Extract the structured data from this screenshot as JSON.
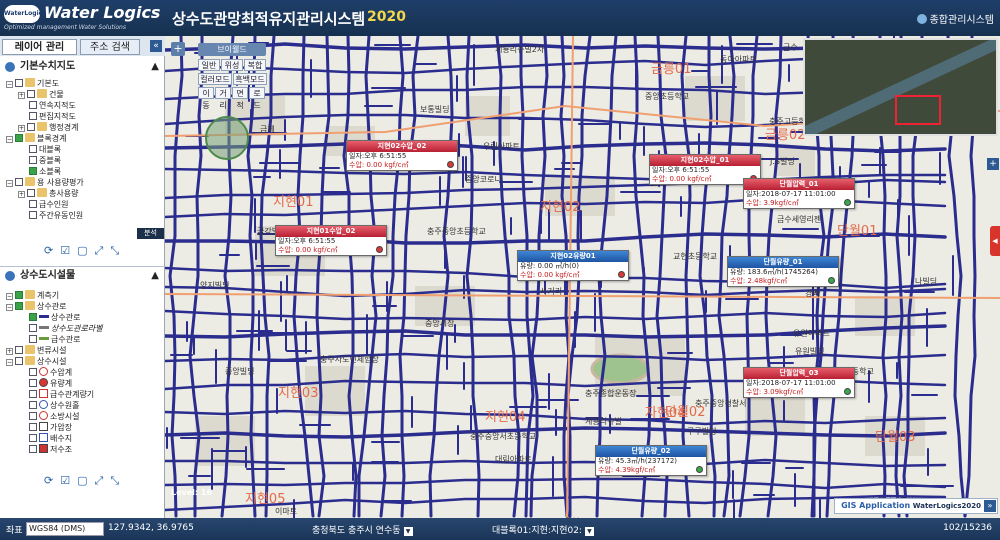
{
  "header": {
    "logo_mark": "WaterLogics",
    "logo_name": "Water Logics",
    "logo_tagline": "Optimized management Water Solutions",
    "title": "상수도관망최적유지관리시스템",
    "year": "2020",
    "global_link": "종합관리시스템"
  },
  "left_panel": {
    "tabs": [
      "레이어 관리",
      "주소 검색"
    ],
    "collapse": "«",
    "section_basic": "기본수치지도",
    "basic_items": [
      "기본도",
      "건물",
      "연속지적도",
      "편집지적도",
      "행정경계",
      "블록경계",
      "대블록",
      "중블록",
      "소블록",
      "용 사용량평가",
      "총사용량",
      "급수인원",
      "주간유동인원"
    ],
    "analysis_tag": "분석",
    "section_water": "상수도시설물",
    "water_items": [
      "계측기",
      "상수관로",
      "상수관로",
      "상수도관로라벨",
      "급수관로",
      "변류시설",
      "상수시설",
      "수압계",
      "유량계",
      "급수관계량기",
      "상수원홀",
      "소방시설",
      "가압장",
      "배수지",
      "저수조"
    ]
  },
  "map": {
    "zoom_plus": "+",
    "brief_btn": "브이웰드",
    "modes_row1": [
      "일반",
      "위성",
      "복합"
    ],
    "modes_row2": [
      "컬러모드",
      "흑백모드"
    ],
    "modes_row3": [
      "이동",
      "거리",
      "면적",
      "로드"
    ],
    "level_label": "Level: 16",
    "gis_label": "GIS Application",
    "gis_brand": "WaterLogics2020",
    "gis_arrow": "»",
    "side_plus": "+",
    "side_handle": "◀",
    "pois": [
      "계룡리슈빌2차",
      "금수",
      "중앙초등학교",
      "우림아파트",
      "중앙코로나",
      "금제",
      "보통빌딩",
      "동아아파트",
      "충주중앙초등학교",
      "사거리",
      "중앙시장",
      "양지빌딩",
      "충주종합운동장",
      "충주사도민체험장",
      "유원빌딩",
      "중앙빌딩",
      "구구빌딩",
      "충주중앙서초등학교",
      "충주중앙경찰서",
      "대림아파트",
      "교현초등학교",
      "사",
      "충주고등학교",
      "충주시청",
      "J.S빌딩",
      "금수세영리젠",
      "계룡리슈빌",
      "충주여자중학교",
      "충주여자고등학교",
      "유원아파트",
      "경비",
      "나빌딩",
      "주봉",
      "이마트",
      "금강빌딩",
      "동수초등학교"
    ],
    "area_labels": [
      "금릉01",
      "지현01",
      "지현02",
      "지현03",
      "지현04",
      "지현05",
      "단월01",
      "단월03",
      "금릉02",
      "자현04",
      "단월02"
    ],
    "popups": [
      {
        "title": "지현02수압_02",
        "line1": "일자:오후 6:51:55",
        "line2": "수압: 0.00 kgf/c㎡",
        "theme": "red",
        "status": "red"
      },
      {
        "title": "지현02수압_01",
        "line1": "일자:오후 6:51:55",
        "line2": "수압: 0.00 kgf/c㎡",
        "theme": "red",
        "status": "red"
      },
      {
        "title": "단월압력_01",
        "line1": "일자:2018-07-17 11:01:00",
        "line2": "수압: 3.9kgf/c㎡",
        "theme": "red",
        "status": "green"
      },
      {
        "title": "지현01수압_02",
        "line1": "일자:오후 6:51:55",
        "line2": "수압: 0.00 kgf/c㎡",
        "theme": "red",
        "status": "red"
      },
      {
        "title": "지현02유량01",
        "line1": "유량: 0.00 ㎥/h(0)",
        "line2": "수압: 0.00 kgf/c㎡",
        "theme": "blue",
        "status": "red"
      },
      {
        "title": "단월유량_01",
        "line1": "유량: 183.6㎥/h(1745264)",
        "line2": "수압: 2.48kgf/c㎡",
        "theme": "blue",
        "status": "green"
      },
      {
        "title": "단월압력_03",
        "line1": "일자:2018-07-17 11:01:00",
        "line2": "수압: 3.09kgf/c㎡",
        "theme": "red",
        "status": "green"
      },
      {
        "title": "단월유량_02",
        "line1": "유량: 45.3㎥/h(237172)",
        "line2": "수압: 4.39kgf/c㎡",
        "theme": "blue",
        "status": "green"
      }
    ]
  },
  "statusbar": {
    "coord_label": "좌표",
    "crs": "WGS84 (DMS)",
    "coords": "127.9342, 36.9765",
    "region": "충청북도 충주시 연수동",
    "block": "대블록01:지현:지현02:",
    "page": "102/15236"
  },
  "colors": {
    "pipe": "#2b2d8e",
    "header": "#1f3f6a",
    "popup_red": "#c82a3d",
    "popup_blue": "#2a65b3"
  }
}
